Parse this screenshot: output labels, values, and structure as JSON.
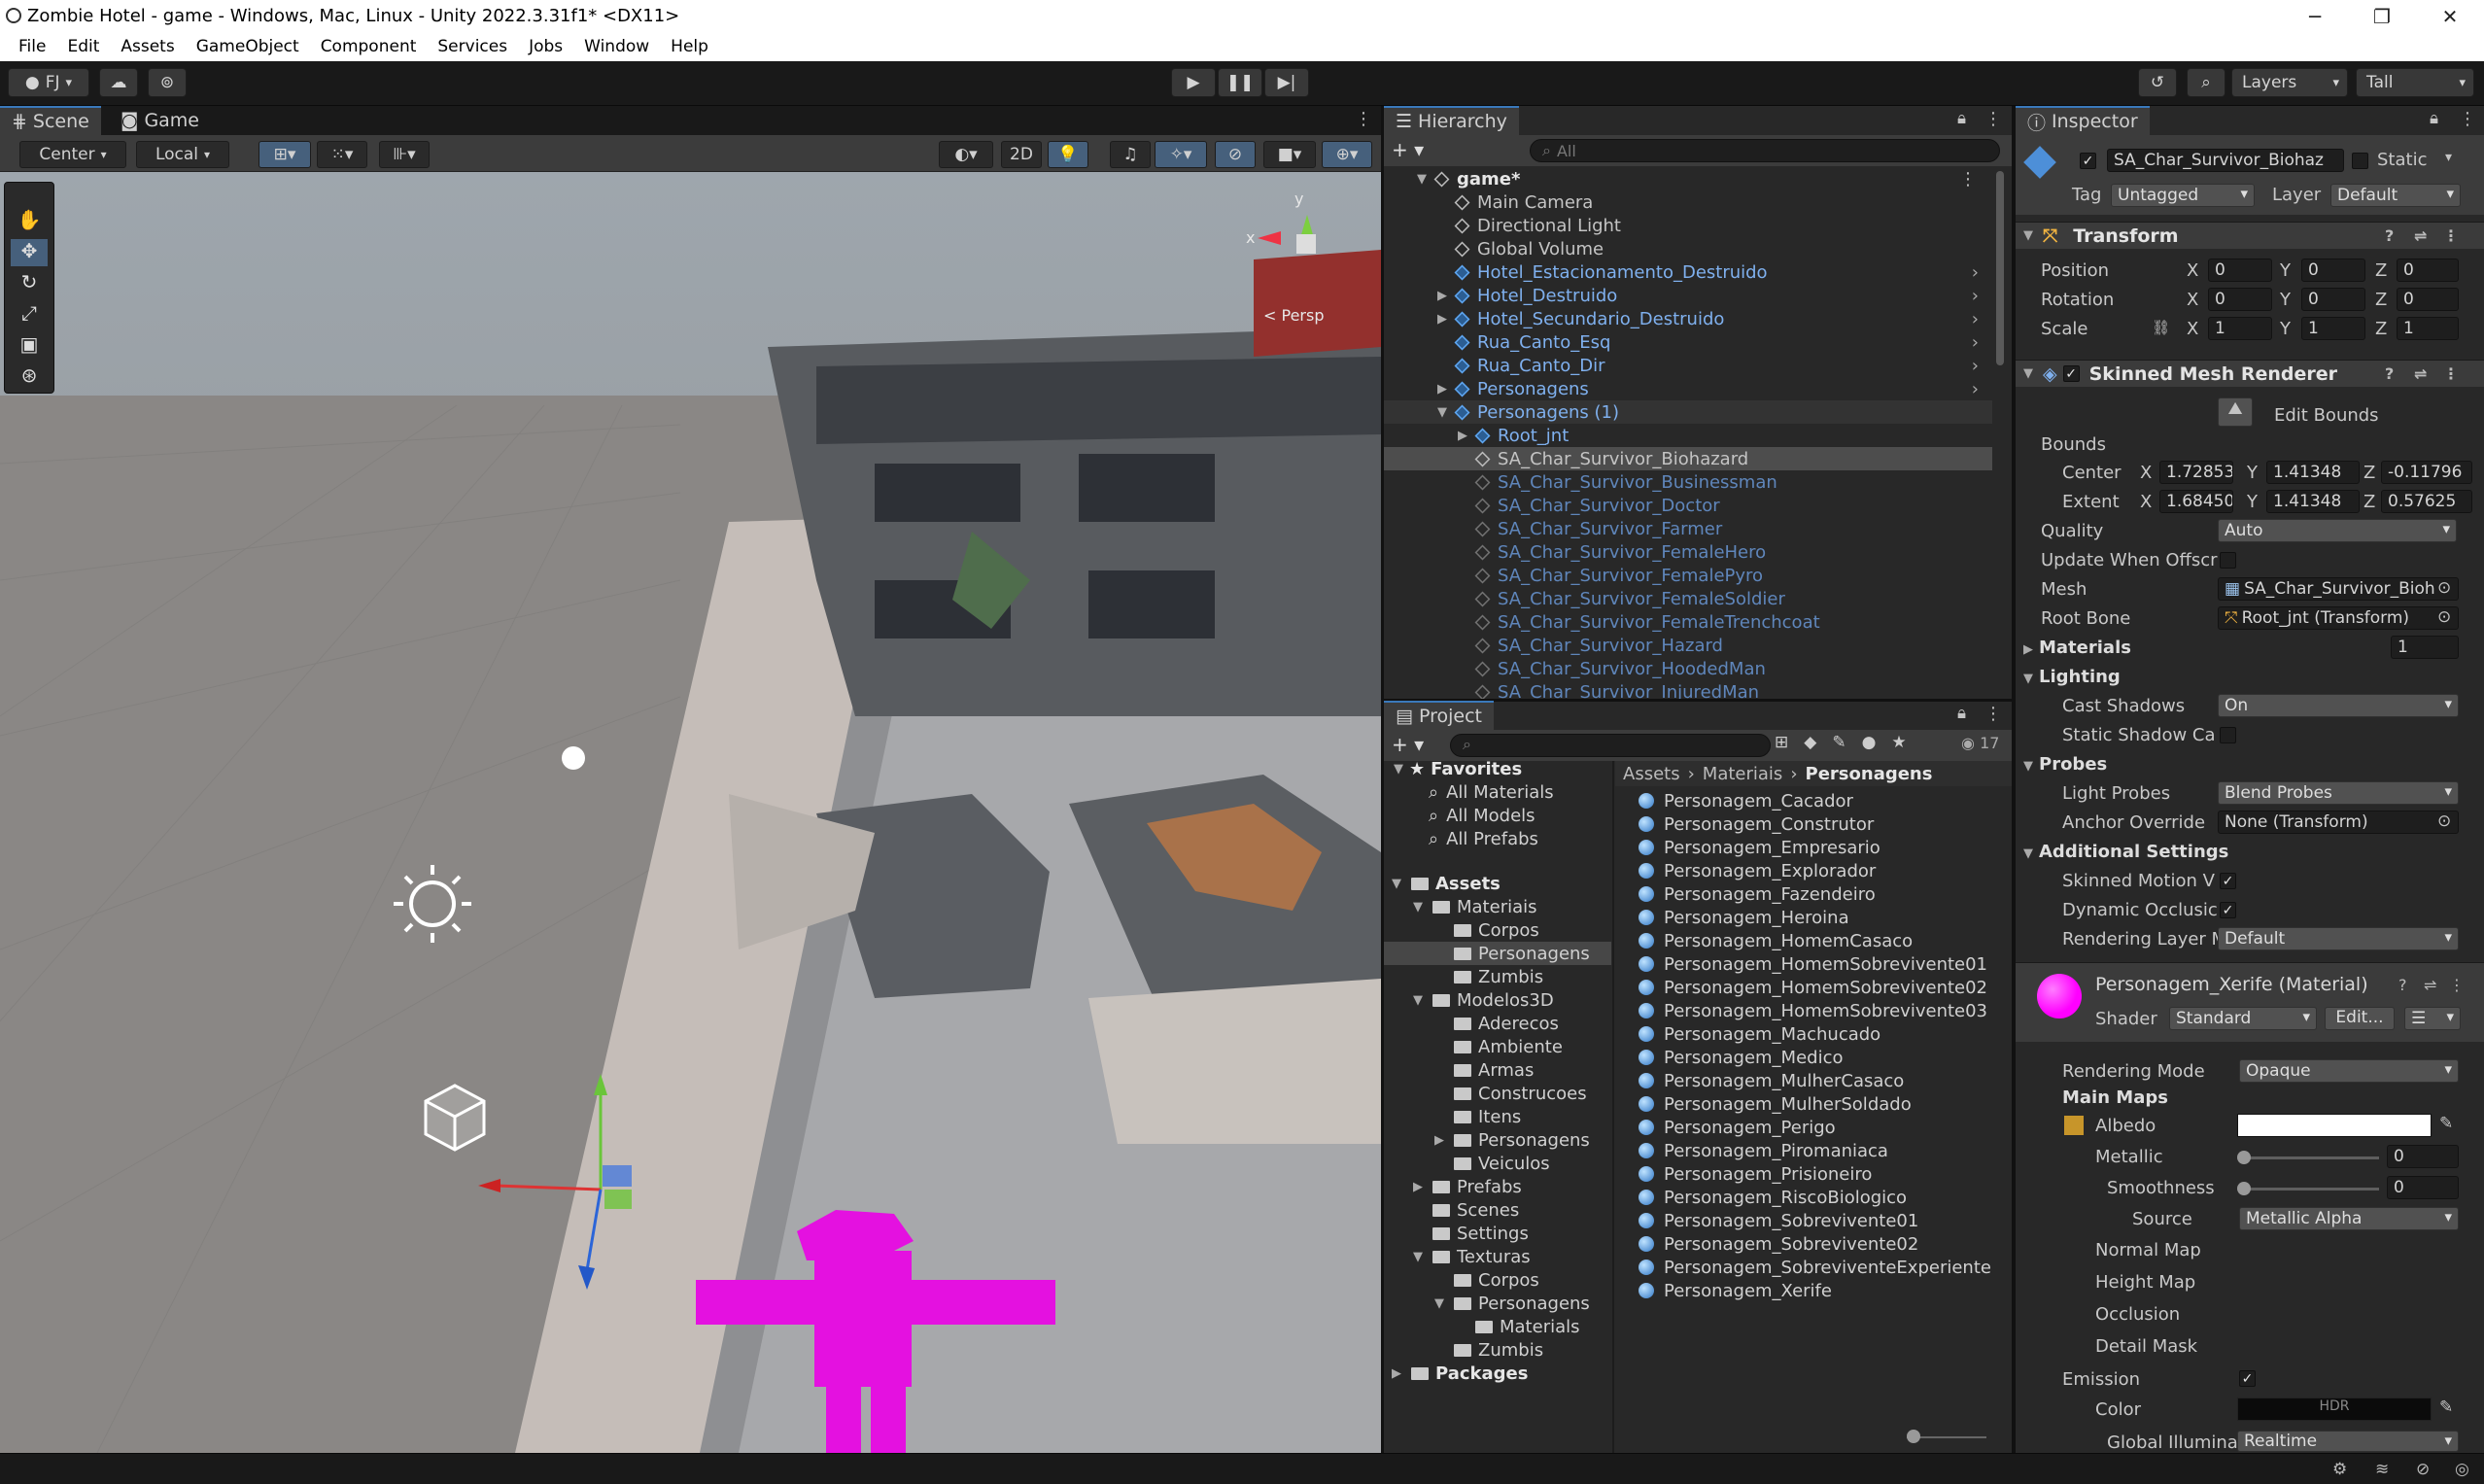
{
  "window": {
    "title": "Zombie Hotel - game - Windows, Mac, Linux - Unity 2022.3.31f1* <DX11>",
    "min": "─",
    "max": "❐",
    "close": "✕"
  },
  "menu": [
    "File",
    "Edit",
    "Assets",
    "GameObject",
    "Component",
    "Services",
    "Jobs",
    "Window",
    "Help"
  ],
  "toolbar": {
    "account": "FJ",
    "layers": "Layers",
    "layout": "Tall"
  },
  "tabs": {
    "scene": "Scene",
    "game": "Game",
    "hierarchy": "Hierarchy",
    "project": "Project",
    "inspector": "Inspector"
  },
  "scene_toolbar": {
    "pivot": "Center",
    "space": "Local",
    "mode2d": "2D"
  },
  "gizmo": {
    "y": "y",
    "x": "x",
    "persp": "< Persp"
  },
  "hierarchy": {
    "search": "All",
    "items": [
      {
        "name": "game*",
        "style": "root"
      },
      {
        "name": "Main Camera",
        "style": "normal"
      },
      {
        "name": "Directional Light",
        "style": "normal"
      },
      {
        "name": "Global Volume",
        "style": "normal"
      },
      {
        "name": "Hotel_Estacionamento_Destruido",
        "style": "prefab"
      },
      {
        "name": "Hotel_Destruido",
        "style": "prefab"
      },
      {
        "name": "Hotel_Secundario_Destruido",
        "style": "prefab"
      },
      {
        "name": "Rua_Canto_Esq",
        "style": "prefab"
      },
      {
        "name": "Rua_Canto_Dir",
        "style": "prefab"
      },
      {
        "name": "Personagens",
        "style": "prefab"
      },
      {
        "name": "Personagens (1)",
        "style": "prefab"
      },
      {
        "name": "Root_jnt",
        "style": "prefab"
      },
      {
        "name": "SA_Char_Survivor_Biohazard",
        "style": "selected"
      },
      {
        "name": "SA_Char_Survivor_Businessman",
        "style": "dim"
      },
      {
        "name": "SA_Char_Survivor_Doctor",
        "style": "dim"
      },
      {
        "name": "SA_Char_Survivor_Farmer",
        "style": "dim"
      },
      {
        "name": "SA_Char_Survivor_FemaleHero",
        "style": "dim"
      },
      {
        "name": "SA_Char_Survivor_FemalePyro",
        "style": "dim"
      },
      {
        "name": "SA_Char_Survivor_FemaleSoldier",
        "style": "dim"
      },
      {
        "name": "SA_Char_Survivor_FemaleTrenchcoat",
        "style": "dim"
      },
      {
        "name": "SA_Char_Survivor_Hazard",
        "style": "dim"
      },
      {
        "name": "SA_Char_Survivor_HoodedMan",
        "style": "dim"
      },
      {
        "name": "SA_Char_Survivor_InjuredMan",
        "style": "dim"
      }
    ]
  },
  "project": {
    "count": "17",
    "breadcrumb": [
      "Assets",
      "Materiais",
      "Personagens"
    ],
    "favorites": {
      "label": "Favorites",
      "items": [
        "All Materials",
        "All Models",
        "All Prefabs"
      ]
    },
    "tree": [
      {
        "name": "Assets",
        "level": 0,
        "bold": true
      },
      {
        "name": "Materiais",
        "level": 1
      },
      {
        "name": "Corpos",
        "level": 2
      },
      {
        "name": "Personagens",
        "level": 2,
        "selected": true
      },
      {
        "name": "Zumbis",
        "level": 2
      },
      {
        "name": "Modelos3D",
        "level": 1
      },
      {
        "name": "Aderecos",
        "level": 2
      },
      {
        "name": "Ambiente",
        "level": 2
      },
      {
        "name": "Armas",
        "level": 2
      },
      {
        "name": "Construcoes",
        "level": 2
      },
      {
        "name": "Itens",
        "level": 2
      },
      {
        "name": "Personagens",
        "level": 2
      },
      {
        "name": "Veiculos",
        "level": 2
      },
      {
        "name": "Prefabs",
        "level": 1
      },
      {
        "name": "Scenes",
        "level": 1
      },
      {
        "name": "Settings",
        "level": 1
      },
      {
        "name": "Texturas",
        "level": 1
      },
      {
        "name": "Corpos",
        "level": 2
      },
      {
        "name": "Personagens",
        "level": 2
      },
      {
        "name": "Materials",
        "level": 3
      },
      {
        "name": "Zumbis",
        "level": 2
      },
      {
        "name": "Packages",
        "level": 0,
        "bold": true
      }
    ],
    "files": [
      "Personagem_Cacador",
      "Personagem_Construtor",
      "Personagem_Empresario",
      "Personagem_Explorador",
      "Personagem_Fazendeiro",
      "Personagem_Heroina",
      "Personagem_HomemCasaco",
      "Personagem_HomemSobrevivente01",
      "Personagem_HomemSobrevivente02",
      "Personagem_HomemSobrevivente03",
      "Personagem_Machucado",
      "Personagem_Medico",
      "Personagem_MulherCasaco",
      "Personagem_MulherSoldado",
      "Personagem_Perigo",
      "Personagem_Piromaniaca",
      "Personagem_Prisioneiro",
      "Personagem_RiscoBiologico",
      "Personagem_Sobrevivente01",
      "Personagem_Sobrevivente02",
      "Personagem_SobreviventeExperiente",
      "Personagem_Xerife"
    ]
  },
  "inspector": {
    "object_name": "SA_Char_Survivor_Biohaz",
    "static": "Static",
    "tag_label": "Tag",
    "tag": "Untagged",
    "layer_label": "Layer",
    "layer": "Default",
    "transform": {
      "title": "Transform",
      "rows": [
        {
          "label": "Position",
          "x": "0",
          "y": "0",
          "z": "0"
        },
        {
          "label": "Rotation",
          "x": "0",
          "y": "0",
          "z": "0"
        },
        {
          "label": "Scale",
          "x": "1",
          "y": "1",
          "z": "1"
        }
      ]
    },
    "smr": {
      "title": "Skinned Mesh Renderer",
      "edit_bounds": "Edit Bounds",
      "bounds": "Bounds",
      "center": {
        "label": "Center",
        "x": "1.72853!",
        "y": "1.41348",
        "z": "-0.11796"
      },
      "extent": {
        "label": "Extent",
        "x": "1.68450",
        "y": "1.41348",
        "z": "0.57625"
      },
      "quality_label": "Quality",
      "quality": "Auto",
      "update_offscreen": "Update When Offscr",
      "mesh_label": "Mesh",
      "mesh": "SA_Char_Survivor_Bioh",
      "rootbone_label": "Root Bone",
      "rootbone": "Root_jnt (Transform)",
      "materials_label": "Materials",
      "materials_count": "1",
      "lighting": "Lighting",
      "cast_shadows_label": "Cast Shadows",
      "cast_shadows": "On",
      "static_shadow": "Static Shadow Ca",
      "probes": "Probes",
      "light_probes_label": "Light Probes",
      "light_probes": "Blend Probes",
      "anchor_label": "Anchor Override",
      "anchor": "None (Transform)",
      "additional": "Additional Settings",
      "skinned_motion": "Skinned Motion V",
      "dynamic_occlusion": "Dynamic Occlusic",
      "rendering_layer_label": "Rendering Layer M",
      "rendering_layer": "Default"
    },
    "material": {
      "title": "Personagem_Xerife (Material)",
      "shader_label": "Shader",
      "shader": "Standard",
      "edit": "Edit...",
      "rendering_mode_label": "Rendering Mode",
      "rendering_mode": "Opaque",
      "main_maps": "Main Maps",
      "albedo": "Albedo",
      "metallic": "Metallic",
      "metallic_value": "0",
      "smoothness": "Smoothness",
      "smoothness_value": "0",
      "source_label": "Source",
      "source": "Metallic Alpha",
      "normal": "Normal Map",
      "height": "Height Map",
      "occlusion": "Occlusion",
      "detail": "Detail Mask",
      "emission": "Emission",
      "color": "Color",
      "hdr": "HDR",
      "gi_label": "Global Illumina",
      "gi": "Realtime",
      "color_hex": "#ff00ff"
    }
  }
}
